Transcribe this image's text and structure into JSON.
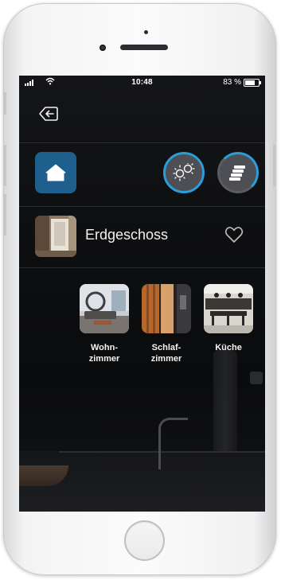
{
  "status_bar": {
    "time": "10:48",
    "battery_text": "83 %",
    "battery_level": 0.83
  },
  "icons": {
    "back": "back-arrow-icon",
    "home": "house-icon",
    "lights": "lightbulbs-icon",
    "scenes": "layers-icon",
    "favorite": "heart-outline-icon"
  },
  "colors": {
    "accent": "#2a9ed8",
    "home_tile": "#1e5f8e",
    "screen_bg": "#0b0c0e"
  },
  "floor": {
    "name": "Erdgeschoss"
  },
  "rooms": [
    {
      "label": "Wohn-\nzimmer"
    },
    {
      "label": "Schlaf-\nzimmer"
    },
    {
      "label": "Küche"
    }
  ]
}
